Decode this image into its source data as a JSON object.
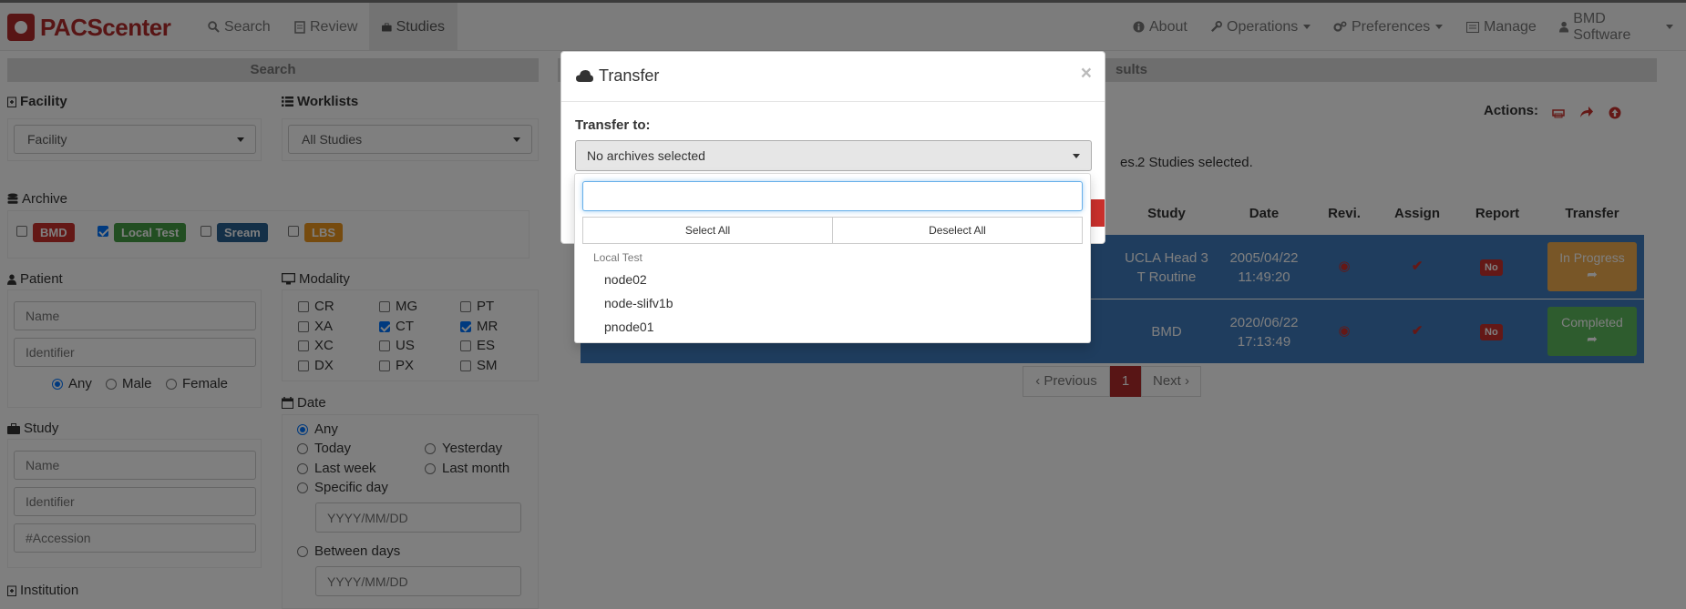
{
  "brand": {
    "name": "PACScenter"
  },
  "nav": {
    "search": "Search",
    "review": "Review",
    "studies": "Studies",
    "about": "About",
    "operations": "Operations",
    "preferences": "Preferences",
    "manage": "Manage",
    "account": "BMD Software"
  },
  "search_panel": {
    "title": "Search",
    "facility": {
      "label": "Facility",
      "value": "Facility"
    },
    "worklists": {
      "label": "Worklists",
      "value": "All Studies"
    },
    "archive": {
      "label": "Archive",
      "items": [
        {
          "label": "BMD",
          "checked": false,
          "color": "#c9302c"
        },
        {
          "label": "Local Test",
          "checked": true,
          "color": "#449d44"
        },
        {
          "label": "Sream",
          "checked": false,
          "color": "#286090"
        },
        {
          "label": "LBS",
          "checked": false,
          "color": "#ec971f"
        }
      ]
    },
    "patient": {
      "label": "Patient",
      "name_placeholder": "Name",
      "identifier_placeholder": "Identifier",
      "gender": [
        "Any",
        "Male",
        "Female"
      ],
      "gender_selected": "Any"
    },
    "modality": {
      "label": "Modality",
      "items": [
        {
          "label": "CR",
          "checked": false
        },
        {
          "label": "MG",
          "checked": false
        },
        {
          "label": "PT",
          "checked": false
        },
        {
          "label": "XA",
          "checked": false
        },
        {
          "label": "CT",
          "checked": true
        },
        {
          "label": "MR",
          "checked": true
        },
        {
          "label": "XC",
          "checked": false
        },
        {
          "label": "US",
          "checked": false
        },
        {
          "label": "ES",
          "checked": false
        },
        {
          "label": "DX",
          "checked": false
        },
        {
          "label": "PX",
          "checked": false
        },
        {
          "label": "SM",
          "checked": false
        }
      ]
    },
    "study": {
      "label": "Study",
      "name_placeholder": "Name",
      "identifier_placeholder": "Identifier",
      "accession_placeholder": "#Accession"
    },
    "date": {
      "label": "Date",
      "options": [
        "Any",
        "Today",
        "Yesterday",
        "Last week",
        "Last month",
        "Specific day",
        "Between days"
      ],
      "selected": "Any",
      "date_placeholder": "YYYY/MM/DD"
    },
    "institution": {
      "label": "Institution"
    }
  },
  "results": {
    "title_fragment": "sults",
    "actions_label": "Actions:",
    "summary_fragment": "es.",
    "selected_text": "2 Studies selected.",
    "columns": [
      "Study",
      "Date",
      "Revi.",
      "Assign",
      "Report",
      "Transfer"
    ],
    "rows": [
      {
        "study_line1": "UCLA Head 3",
        "study_line2": "T Routine",
        "date": "2005/04/22",
        "time": "11:49:20",
        "report": "No",
        "transfer": "In Progress",
        "transfer_color": "#f0ad4e"
      },
      {
        "study_line1": "BMD",
        "study_line2": "",
        "date": "2020/06/22",
        "time": "17:13:49",
        "report": "No",
        "transfer": "Completed",
        "transfer_color": "#5cb85c"
      }
    ],
    "pagination": {
      "previous": "Previous",
      "current": "1",
      "next": "Next"
    }
  },
  "modal": {
    "title": "Transfer",
    "close": "×",
    "transfer_to_label": "Transfer to:",
    "select_value": "No archives selected",
    "search_value": "",
    "select_all": "Select All",
    "deselect_all": "Deselect All",
    "group": "Local Test",
    "options": [
      "node02",
      "node-slifv1b",
      "pnode01"
    ]
  }
}
